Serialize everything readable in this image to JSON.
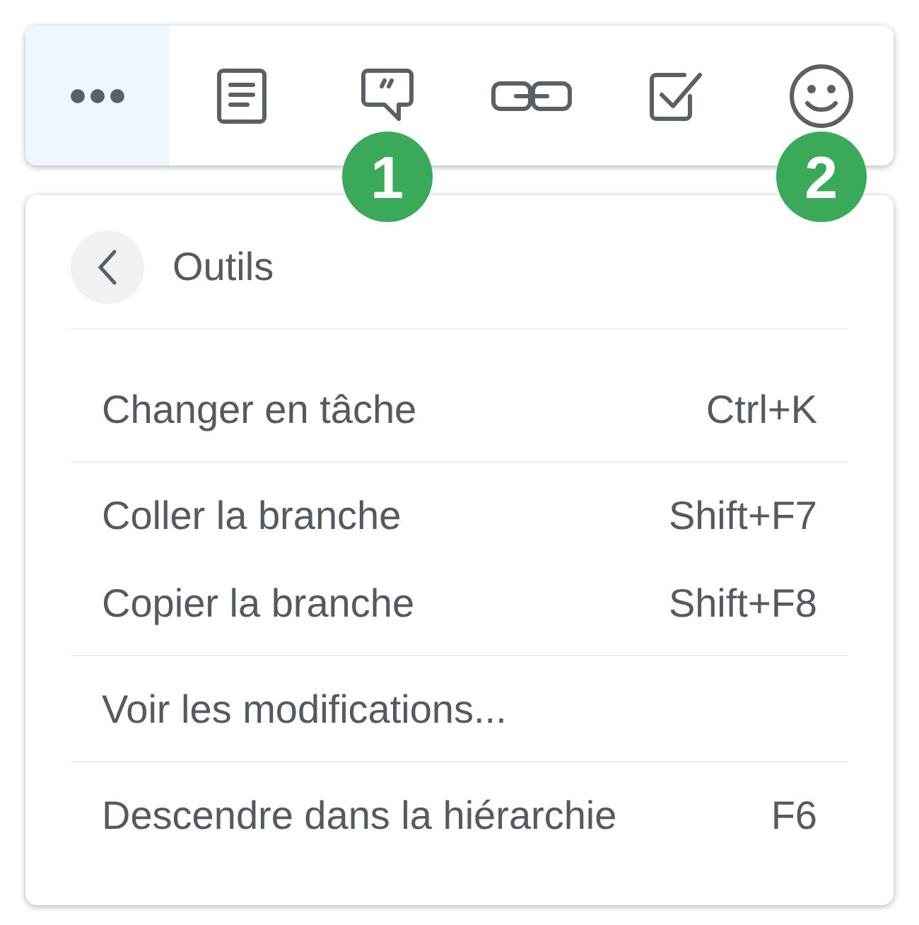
{
  "toolbar": {
    "tools": [
      {
        "kind": "more",
        "selected": true
      },
      {
        "kind": "note",
        "selected": false
      },
      {
        "kind": "quote",
        "selected": false,
        "badge": "1"
      },
      {
        "kind": "link",
        "selected": false
      },
      {
        "kind": "task",
        "selected": false
      },
      {
        "kind": "emoji",
        "selected": false,
        "badge": "2"
      }
    ]
  },
  "menu": {
    "title": "Outils",
    "sections": [
      [
        {
          "label": "Changer en tâche",
          "shortcut": "Ctrl+K"
        }
      ],
      [
        {
          "label": "Coller la branche",
          "shortcut": "Shift+F7"
        },
        {
          "label": "Copier la branche",
          "shortcut": "Shift+F8"
        }
      ],
      [
        {
          "label": "Voir les modifications..."
        }
      ],
      [
        {
          "label": "Descendre dans la hiérarchie",
          "shortcut": "F6"
        }
      ]
    ]
  }
}
